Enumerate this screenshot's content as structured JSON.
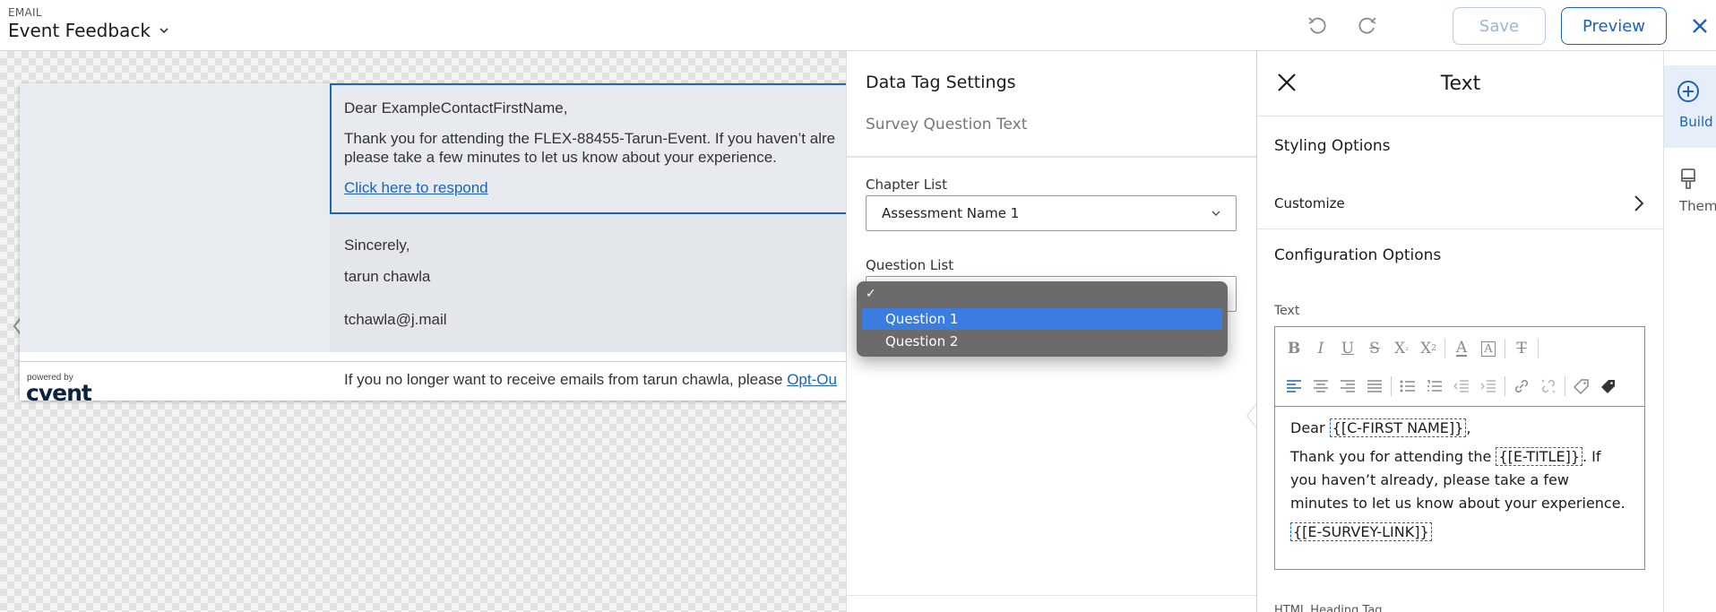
{
  "header": {
    "eyebrow": "EMAIL",
    "title": "Event Feedback",
    "save_label": "Save",
    "preview_label": "Preview"
  },
  "email_preview": {
    "greeting": "Dear ExampleContactFirstName,",
    "line1": "Thank you for attending the FLEX-88455-Tarun-Event. If you haven’t alre",
    "line2": "please take a few minutes to let us know about your experience.",
    "link": "Click here to respond",
    "sincerely": "Sincerely,",
    "sender_name": "tarun chawla",
    "sender_email": "tchawla@j.mail",
    "optout_text": "If you no longer want to receive emails from tarun chawla, please ",
    "optout_link": "Opt-Ou",
    "powered_by": "powered by",
    "brand": "cvent"
  },
  "data_tag_settings": {
    "title": "Data Tag Settings",
    "subtitle": "Survey Question Text",
    "chapter_label": "Chapter List",
    "chapter_value": "Assessment Name 1",
    "question_label": "Question List",
    "question_options": [
      "Question 1",
      "Question 2"
    ],
    "question_selected": "Question 1"
  },
  "text_panel": {
    "title": "Text",
    "styling_options": "Styling Options",
    "customize": "Customize",
    "configuration_options": "Configuration Options",
    "text_label": "Text",
    "content": {
      "dear": "Dear ",
      "first_name_tag": "{[C-FIRST NAME]}",
      "thanks_pre": "Thank you for attending the ",
      "title_tag": "{[E-TITLE]}",
      "thanks_post": ". If you haven’t already, please take a few minutes to let us know about your experience.",
      "survey_tag": "{[E-SURVEY-LINK]}"
    },
    "bottom_label": "HTML Heading Tag"
  },
  "rail": {
    "build": "Build",
    "theme": "Theme"
  },
  "colors": {
    "accent": "#1d63b8",
    "dropdown_bg": "#6c6a6a",
    "dropdown_selected": "#3a7ce0"
  }
}
